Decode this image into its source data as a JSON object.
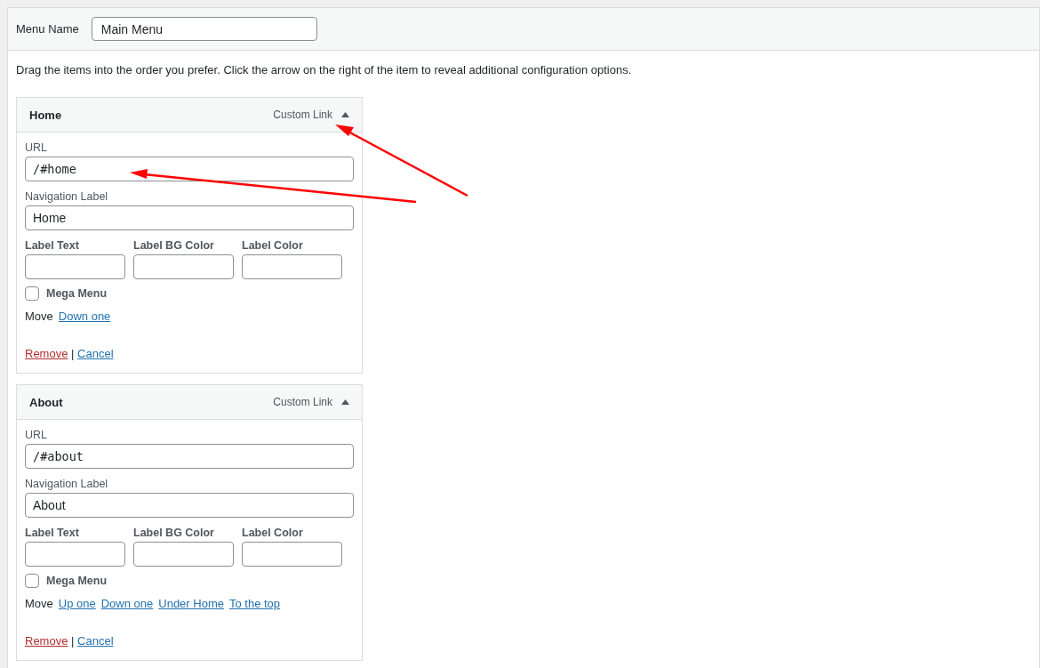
{
  "menu_name": {
    "label": "Menu Name",
    "value": "Main Menu"
  },
  "instructions": "Drag the items into the order you prefer. Click the arrow on the right of the item to reveal additional configuration options.",
  "items": [
    {
      "title": "Home",
      "type_label": "Custom Link",
      "expanded": true,
      "url_label": "URL",
      "url": "/#home",
      "nav_label_label": "Navigation Label",
      "nav_label": "Home",
      "small_fields": [
        "Label Text",
        "Label BG Color",
        "Label Color"
      ],
      "mega_menu": {
        "label": "Mega Menu",
        "checked": false
      },
      "move_label": "Move",
      "move_links": [
        "Down one"
      ],
      "remove": "Remove",
      "separator": "|",
      "cancel": "Cancel"
    },
    {
      "title": "About",
      "type_label": "Custom Link",
      "expanded": true,
      "url_label": "URL",
      "url": "/#about",
      "nav_label_label": "Navigation Label",
      "nav_label": "About",
      "small_fields": [
        "Label Text",
        "Label BG Color",
        "Label Color"
      ],
      "mega_menu": {
        "label": "Mega Menu",
        "checked": false
      },
      "move_label": "Move",
      "move_links": [
        "Up one",
        "Down one",
        "Under Home",
        "To the top"
      ],
      "remove": "Remove",
      "separator": "|",
      "cancel": "Cancel"
    }
  ]
}
